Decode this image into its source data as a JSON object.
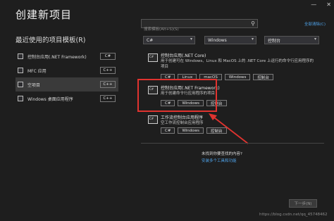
{
  "window": {
    "title": "创建新项目",
    "minimize_glyph": "—",
    "close_glyph": "✕"
  },
  "recent": {
    "heading": "最近使用的项目模板(R)",
    "items": [
      {
        "label": "控制台应用(.NET Framework)",
        "lang": "C#",
        "icon": "console-app-icon"
      },
      {
        "label": "MFC 应用",
        "lang": "C++",
        "icon": "mfc-app-icon"
      },
      {
        "label": "空项目",
        "lang": "C++",
        "icon": "empty-project-icon"
      },
      {
        "label": "Windows 桌面应用程序",
        "lang": "C++",
        "icon": "windows-desktop-icon"
      }
    ]
  },
  "search": {
    "placeholder": "搜索模板(Alt+S)(S)",
    "icon": "search-icon",
    "clear_all": "全部清除(C)"
  },
  "filters": {
    "language": "C#",
    "platform": "Windows",
    "project_type": "控制台",
    "chevron": "▾"
  },
  "templates": [
    {
      "title": "控制台应用(.NET Core)",
      "desc_line1": "用于创建可在 Windows、Linux 和 MacOS 上的 .NET Core 上运行的命令行应用程序的",
      "desc_line2": "项目",
      "tags": [
        "C#",
        "Linux",
        "macOS",
        "Windows",
        "控制台"
      ],
      "icon_text": "C#"
    },
    {
      "title": "控制台应用(.NET Framework)",
      "desc_line1": "用于创建命令行应用程序的项目",
      "tags": [
        "C#",
        "Windows",
        "控制台"
      ],
      "icon_text": "C#"
    },
    {
      "title": "工作流控制台应用程序",
      "desc_line1": "空工作流控制台应用程序",
      "tags": [
        "C#",
        "Windows",
        "控制台"
      ],
      "icon_text": "C#"
    }
  ],
  "not_found": {
    "question": "未找到你要查找的内容?",
    "link": "安装多个工具和功能"
  },
  "footer": {
    "next_button": "下一步(N)",
    "watermark": "https://blog.csdn.net/qq_45748462"
  },
  "colors": {
    "background": "#1e1e1e",
    "highlight_red": "#e0332f",
    "link_blue": "#4fa3ea"
  }
}
